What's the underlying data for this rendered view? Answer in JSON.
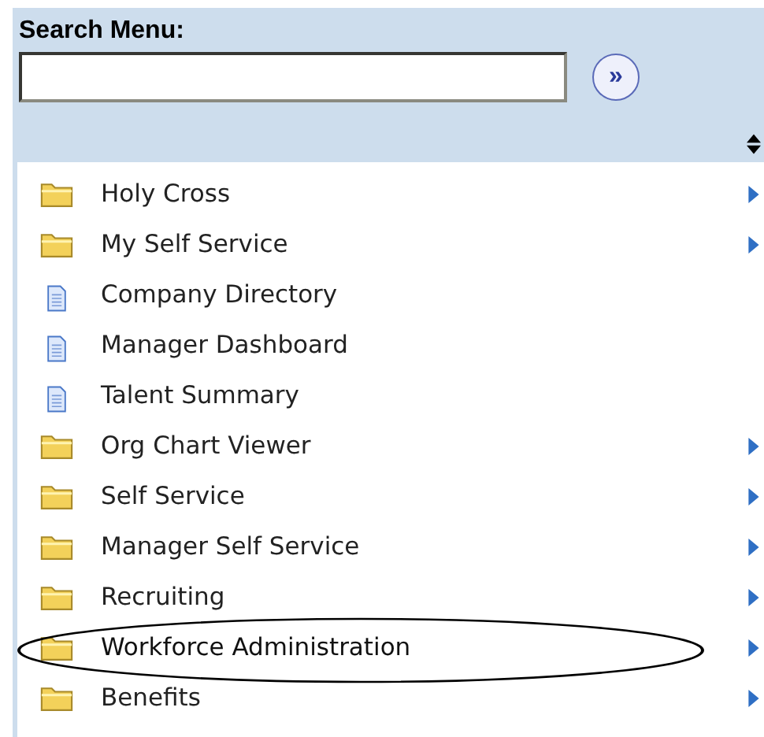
{
  "search": {
    "label": "Search Menu:",
    "go_symbol": "»"
  },
  "menu": [
    {
      "label": "Holy Cross",
      "kind": "folder",
      "circled": false
    },
    {
      "label": "My Self Service",
      "kind": "folder",
      "circled": false
    },
    {
      "label": "Company Directory",
      "kind": "page",
      "circled": false
    },
    {
      "label": "Manager Dashboard",
      "kind": "page",
      "circled": false
    },
    {
      "label": "Talent Summary",
      "kind": "page",
      "circled": false
    },
    {
      "label": "Org Chart Viewer",
      "kind": "folder",
      "circled": false
    },
    {
      "label": "Self Service",
      "kind": "folder",
      "circled": false
    },
    {
      "label": "Manager Self Service",
      "kind": "folder",
      "circled": false
    },
    {
      "label": "Recruiting",
      "kind": "folder",
      "circled": false
    },
    {
      "label": "Workforce Administration",
      "kind": "folder",
      "circled": true
    },
    {
      "label": "Benefits",
      "kind": "folder",
      "circled": false
    }
  ]
}
